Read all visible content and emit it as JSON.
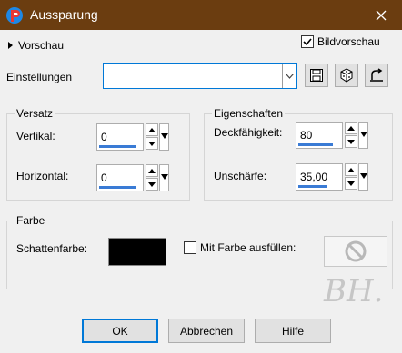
{
  "window": {
    "title": "Aussparung"
  },
  "preview": {
    "label": "Vorschau",
    "bild_label": "Bildvorschau",
    "bild_checked": true
  },
  "settings": {
    "label": "Einstellungen",
    "value": ""
  },
  "versatz": {
    "legend": "Versatz",
    "vertikal": {
      "label": "Vertikal:",
      "value": "0"
    },
    "horizontal": {
      "label": "Horizontal:",
      "value": "0"
    }
  },
  "eigenschaften": {
    "legend": "Eigenschaften",
    "deckfaehigkeit": {
      "label": "Deckfähigkeit:",
      "value": "80"
    },
    "unschaerfe": {
      "label": "Unschärfe:",
      "value": "35,00"
    }
  },
  "farbe": {
    "legend": "Farbe",
    "schatten_label": "Schattenfarbe:",
    "schatten_color": "#000000",
    "fill_label": "Mit Farbe ausfüllen:",
    "fill_checked": false
  },
  "buttons": {
    "ok": "OK",
    "cancel": "Abbrechen",
    "help": "Hilfe"
  },
  "watermark": "BH.",
  "colors": {
    "titlebar": "#6b3d10",
    "accent": "#0078d7",
    "spin_bar": "#3a7bd5"
  }
}
